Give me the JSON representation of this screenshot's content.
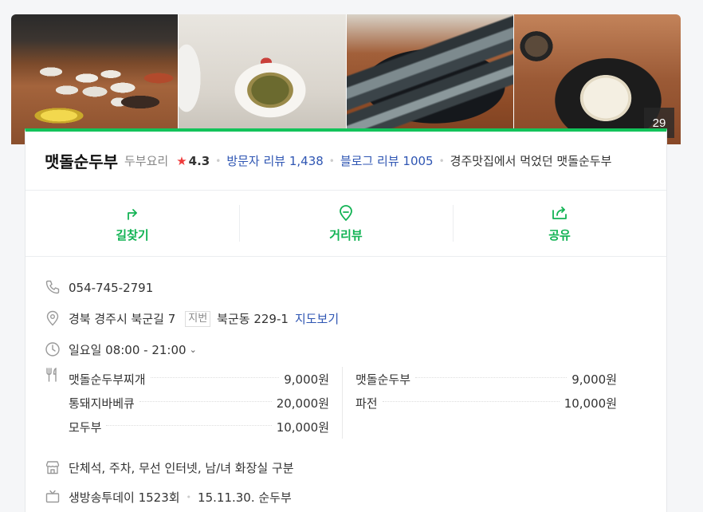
{
  "photos": {
    "count": "29",
    "items": [
      "photo-1",
      "photo-2",
      "photo-3",
      "photo-4"
    ]
  },
  "place": {
    "name": "맷돌순두부",
    "category": "두부요리",
    "rating": "4.3",
    "visitor_review_label": "방문자 리뷰 1,438",
    "blog_review_label": "블로그 리뷰 1005",
    "description": "경주맛집에서 먹었던 맷돌순두부"
  },
  "actions": [
    {
      "label": "길찾기",
      "icon": "directions-icon"
    },
    {
      "label": "거리뷰",
      "icon": "streetview-icon"
    },
    {
      "label": "공유",
      "icon": "share-icon"
    }
  ],
  "info": {
    "phone": "054-745-2791",
    "address": "경북 경주시 북군길 7",
    "jibun_label": "지번",
    "jibun": "북군동 229-1",
    "map_link": "지도보기",
    "hours": "일요일 08:00 - 21:00",
    "menu": [
      {
        "name": "맷돌순두부찌개",
        "price": "9,000원"
      },
      {
        "name": "맷돌순두부",
        "price": "9,000원"
      },
      {
        "name": "통돼지바베큐",
        "price": "20,000원"
      },
      {
        "name": "파전",
        "price": "10,000원"
      },
      {
        "name": "모두부",
        "price": "10,000원"
      }
    ],
    "facilities": "단체석, 주차, 무선 인터넷, 남/녀 화장실 구분",
    "tv_show": "생방송투데이 1523회",
    "tv_date": "15.11.30. 순두부"
  },
  "colors": {
    "accent_green": "#12c35a",
    "link_blue": "#2f56b3",
    "star_red": "#ef3b3b"
  }
}
